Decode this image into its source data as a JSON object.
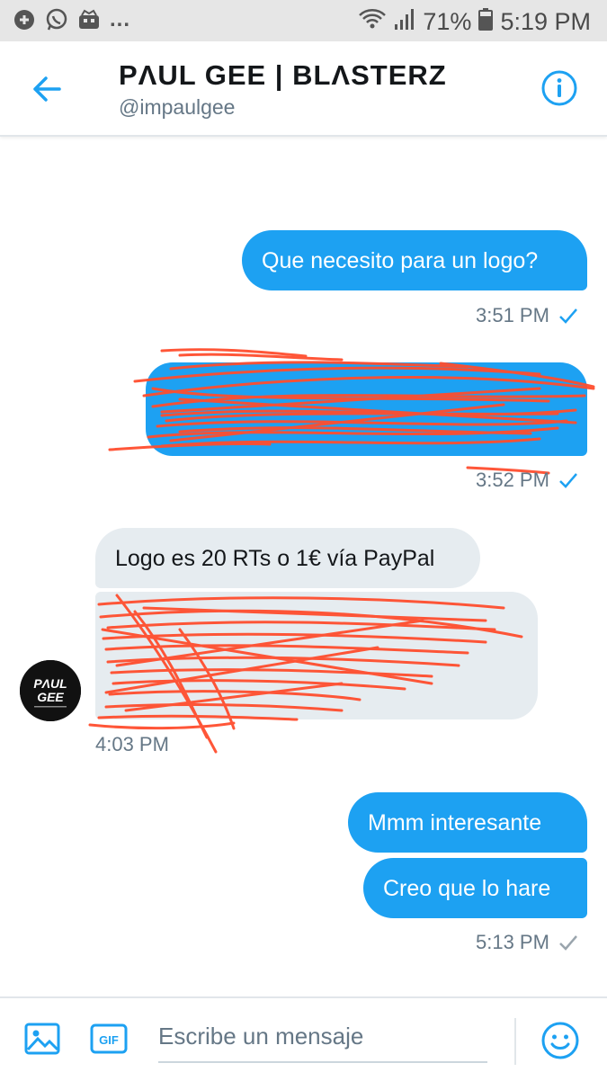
{
  "status_bar": {
    "battery": "71%",
    "time": "5:19 PM",
    "more": "..."
  },
  "header": {
    "name": "PΛUL GEE | BLΛSTERZ",
    "handle": "@impaulgee"
  },
  "messages": [
    {
      "side": "out",
      "text": "Que necesito para un logo?",
      "time": "3:51 PM"
    },
    {
      "side": "out",
      "text": "",
      "time": "3:52 PM",
      "redacted": true
    },
    {
      "side": "in",
      "text": "Logo es 20 RTs o 1€ vía PayPal"
    },
    {
      "side": "in",
      "text": "",
      "time": "4:03 PM",
      "redacted": true
    },
    {
      "side": "out",
      "text": "Mmm interesante"
    },
    {
      "side": "out",
      "text": "Creo que lo hare",
      "time": "5:13 PM"
    }
  ],
  "avatar": {
    "line1": "PΛUL",
    "line2": "GEE"
  },
  "composer": {
    "placeholder": "Escribe un mensaje",
    "gif_label": "GIF"
  },
  "colors": {
    "accent": "#1da1f2",
    "incoming_bubble": "#e6ecf0",
    "scribble": "#ff4d2e"
  },
  "icons": [
    "sb-app-icon",
    "whatsapp-icon",
    "sb-bot-icon",
    "wifi-icon",
    "signal-icon",
    "battery-icon",
    "back-arrow-icon",
    "info-icon",
    "check-icon",
    "image-icon",
    "gif-icon",
    "emoji-icon"
  ]
}
